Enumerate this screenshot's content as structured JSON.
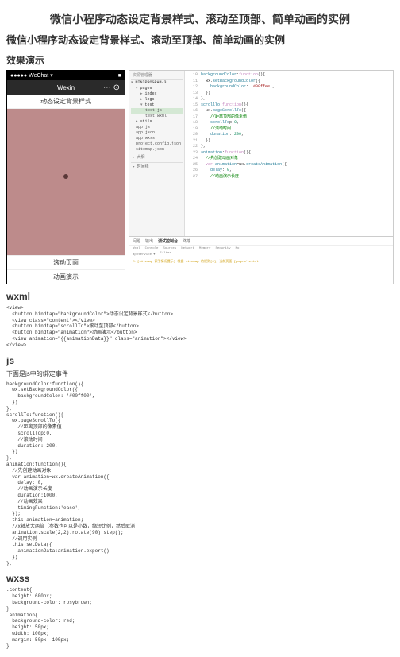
{
  "titles": {
    "main": "微信小程序动态设定背景样式、滚动至顶部、简单动画的实例",
    "sub": "微信小程序动态设定背景样式、滚动至顶部、简单动画的实例",
    "demo": "效果演示"
  },
  "phone": {
    "status_left": "●●●●● WeChat ▾",
    "status_right": "■",
    "header_title": "Wexin",
    "header_icon": "⋯ ⊙",
    "section1": "动态设定背景样式",
    "section2": "滚动页面",
    "section3": "动画演示"
  },
  "ide": {
    "tree_header": "资源管理器",
    "project_root": "MINIPROGRAM-3",
    "folders": {
      "pages": "pages",
      "index": "index",
      "logs": "logs",
      "test": "test",
      "utils": "utils"
    },
    "files": {
      "testjs": "test.js",
      "testwxml": "test.wxml",
      "appjs": "app.js",
      "appjson": "app.json",
      "appwxss": "app.wxss",
      "projectconfig": "project.config.json",
      "sitemap": "sitemap.json"
    },
    "tree_bottom1": "▸ 大纲",
    "tree_bottom2": "▸ 时间线",
    "code_lines": [
      {
        "n": 10,
        "t": "backgroundColor:function(){"
      },
      {
        "n": 11,
        "t": "  wx.setBackgroundColor({"
      },
      {
        "n": 12,
        "t": "    backgroundColor: '#00ffee',"
      },
      {
        "n": 13,
        "t": "  })"
      },
      {
        "n": 14,
        "t": "},"
      },
      {
        "n": 15,
        "t": "scrollTo:function(){"
      },
      {
        "n": 16,
        "t": "  wx.pageScrollTo({"
      },
      {
        "n": 17,
        "t": "    //距离顶部的像素值"
      },
      {
        "n": 18,
        "t": "    scrollTop:0,"
      },
      {
        "n": 19,
        "t": "    //滚动时间"
      },
      {
        "n": 20,
        "t": "    duration: 200,"
      },
      {
        "n": 21,
        "t": "  })"
      },
      {
        "n": 22,
        "t": "},"
      },
      {
        "n": 23,
        "t": "animation:function(){"
      },
      {
        "n": 24,
        "t": "  //先创建动画对象"
      },
      {
        "n": 25,
        "t": "  var animation=wx.createAnimation({"
      },
      {
        "n": 26,
        "t": "    delay: 0,"
      },
      {
        "n": 27,
        "t": "    //动画演示长度"
      }
    ],
    "console": {
      "tabs": [
        "问题",
        "输出",
        "调试控制台",
        "终端"
      ],
      "subtabs": [
        "Wxml",
        "Console",
        "Sources",
        "Network",
        "Memory",
        "Security",
        "Mo"
      ],
      "filter": "appservice ▾",
      "filter2": "Filter",
      "msg": "[sitemap 索引情况提示] 根据 sitemap 的规则[0]，当前页面 [pages/test/t"
    }
  },
  "sections": {
    "wxml": "wxml",
    "js": "js",
    "js_note": "下面是js中的绑定事件",
    "wxss": "wxss"
  },
  "wxml_code": "<view>\n  <button bindtap=\"backgroundColor\">动态设定背景样式</button>\n  <view class=\"content\"></view>\n  <button bindtap=\"scrollTo\">滚动至顶部</button>\n  <button bindtap=\"animation\">动画演示</button>\n  <view animation=\"{{animationData}}\" class=\"animation\"></view>\n</view>",
  "js_code": "backgroundColor:function(){\n  wx.setBackgroundColor({\n    backgroundColor: '#00ff00',\n  })\n},\nscrollTo:function(){\n  wx.pageScrollTo({\n    //距离顶部的像素值\n    scrollTop:0,\n    //滚动时间\n    duration: 200,\n  })\n},\nanimation:function(){\n  //先创建动画对象\n  var animation=wx.createAnimation({\n    delay: 0,\n    //动画演示长度\n    duration:1000,\n    //动画效果\n    timingFunction:'ease',\n  });\n  this.animation=animation;\n  //x轴放大两倍（参数也可以是小数，缩短比例，然后取消\n  animation.scale(2,2).rotate(90).step();\n  //调用实例\n  this.setData({\n    animationData:animation.export()\n  })\n},",
  "wxss_code": ".content{\n  height: 600px;\n  background-color: rosybrown;\n}\n.animation{\n  background-color: red;\n  height: 50px;\n  width: 100px;\n  margin: 50px  100px;\n}"
}
